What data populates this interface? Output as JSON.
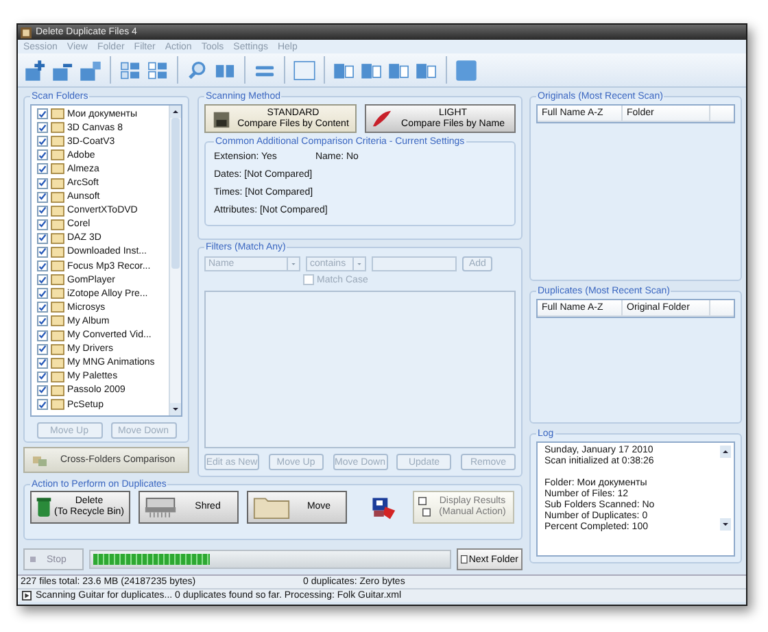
{
  "window": {
    "title": "Delete Duplicate Files 4"
  },
  "menu": [
    "Session",
    "View",
    "Folder",
    "Filter",
    "Action",
    "Tools",
    "Settings",
    "Help"
  ],
  "scan_folders": {
    "title": "Scan Folders",
    "items": [
      {
        "label": "Мои документы",
        "checked": true
      },
      {
        "label": "3D Canvas 8",
        "checked": true
      },
      {
        "label": "3D-CoatV3",
        "checked": true
      },
      {
        "label": "Adobe",
        "checked": true
      },
      {
        "label": "Almeza",
        "checked": true
      },
      {
        "label": "ArcSoft",
        "checked": true
      },
      {
        "label": "Aunsoft",
        "checked": true
      },
      {
        "label": "ConvertXToDVD",
        "checked": true
      },
      {
        "label": "Corel",
        "checked": true
      },
      {
        "label": "DAZ 3D",
        "checked": true
      },
      {
        "label": "Downloaded Inst...",
        "checked": true
      },
      {
        "label": "Focus Mp3 Recor...",
        "checked": true
      },
      {
        "label": "GomPlayer",
        "checked": true
      },
      {
        "label": "iZotope Alloy Pre...",
        "checked": true
      },
      {
        "label": "Microsys",
        "checked": true
      },
      {
        "label": "My Album",
        "checked": true
      },
      {
        "label": "My Converted Vid...",
        "checked": true
      },
      {
        "label": "My Drivers",
        "checked": true
      },
      {
        "label": "My MNG Animations",
        "checked": true
      },
      {
        "label": "My Palettes",
        "checked": true
      },
      {
        "label": "Passolo 2009",
        "checked": true
      },
      {
        "label": "PcSetup",
        "checked": true
      }
    ],
    "buttons": [
      {
        "label": "Move Up",
        "disabled": true
      },
      {
        "label": "Move Down",
        "disabled": true
      }
    ],
    "cross_button": "Cross-Folders Comparison"
  },
  "scanning_method": {
    "title": "Scanning Method",
    "options": [
      {
        "title": "STANDARD",
        "subtitle": "Compare Files by Content",
        "selected": true
      },
      {
        "title": "LIGHT",
        "subtitle": "Compare Files by Name",
        "selected": false
      }
    ],
    "criteria": {
      "title": "Common Additional Comparison Criteria - Current Settings",
      "rows": [
        [
          "Extension: Yes",
          "Name: No"
        ],
        [
          "Dates:  [Not Compared]"
        ],
        [
          "Times:  [Not Compared]"
        ],
        [
          "Attributes:  [Not Compared]"
        ]
      ]
    }
  },
  "filters": {
    "title": "Filters (Match Any)",
    "field": "Name",
    "operator": "contains",
    "add": "Add",
    "match_case": {
      "label": "Match Case",
      "checked": false
    },
    "buttons": [
      {
        "label": "Edit as New",
        "disabled": true
      },
      {
        "label": "Move Up",
        "disabled": true
      },
      {
        "label": "Move Down",
        "disabled": true
      },
      {
        "label": "Update",
        "disabled": true
      },
      {
        "label": "Remove",
        "disabled": true
      }
    ]
  },
  "originals": {
    "title": "Originals (Most Recent Scan)",
    "columns": [
      "Full Name A-Z",
      "Folder"
    ]
  },
  "duplicates": {
    "title": "Duplicates (Most Recent Scan)",
    "columns": [
      "Full Name A-Z",
      "Original Folder"
    ]
  },
  "log": {
    "title": "Log",
    "paragraphs": [
      [
        "Sunday, January 17 2010",
        "Scan initialized at 0:38:26"
      ],
      [
        "Folder: Мои документы",
        "Number of Files: 12",
        "Sub Folders Scanned: No",
        "Number of Duplicates: 0",
        "Percent Completed: 100"
      ]
    ]
  },
  "actions": {
    "title": "Action to Perform on Duplicates",
    "buttons": [
      {
        "kind": "recycle",
        "lines": [
          "Delete",
          "(To Recycle Bin)"
        ],
        "selected": false
      },
      {
        "kind": "shred",
        "lines": [
          "Shred"
        ],
        "selected": false
      },
      {
        "kind": "move",
        "lines": [
          "Move"
        ],
        "selected": false
      },
      {
        "kind": "results",
        "lines": [
          "Display Results",
          "(Manual Action)"
        ],
        "selected": true
      }
    ]
  },
  "progress": {
    "stop": {
      "label": "Stop",
      "disabled": true
    },
    "level": 0.33,
    "next": "Next Folder"
  },
  "status_bar": {
    "files": "227 files total: 23.6 MB (24187235 bytes)",
    "duplicates": "0 duplicates: Zero bytes",
    "message": "Scanning Guitar for duplicates...  0 duplicates found so far. Processing: Folk Guitar.xml"
  }
}
